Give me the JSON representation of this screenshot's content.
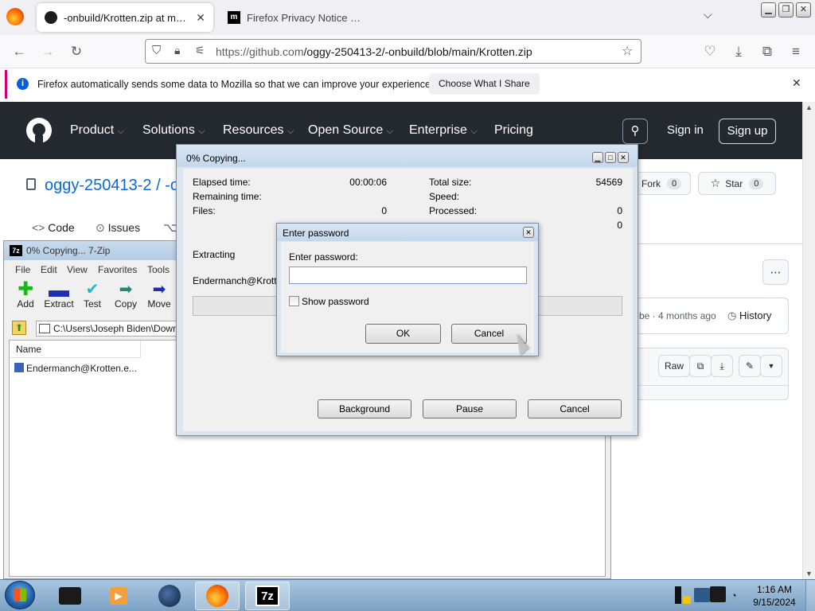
{
  "browser": {
    "tabs": [
      {
        "label": "-onbuild/Krotten.zip at main · o",
        "active": true
      },
      {
        "label": "Firefox Privacy Notice — Mo",
        "active": false
      }
    ],
    "url_domain": "https://github.com",
    "url_path": "/oggy-250413-2/-onbuild/blob/main/Krotten.zip",
    "notification": {
      "message": "Firefox automatically sends some data to Mozilla so that we can improve your experience.",
      "button": "Choose What I Share"
    }
  },
  "github": {
    "nav": [
      "Product",
      "Solutions",
      "Resources",
      "Open Source",
      "Enterprise",
      "Pricing"
    ],
    "sign_in": "Sign in",
    "sign_up": "Sign up",
    "repo_owner": "oggy-250413-2",
    "repo_sep": "/ -o",
    "fork_label": "Fork",
    "fork_count": "0",
    "star_label": "Star",
    "star_count": "0",
    "tabs": [
      "Code",
      "Issues"
    ],
    "commit_info": "be · 4 months ago",
    "history": "History",
    "raw": "Raw"
  },
  "sevenzip": {
    "title": "0% Copying... 7-Zip",
    "menu": [
      "File",
      "Edit",
      "View",
      "Favorites",
      "Tools"
    ],
    "toolbar": [
      "Add",
      "Extract",
      "Test",
      "Copy",
      "Move"
    ],
    "path": "C:\\Users\\Joseph Biden\\Down",
    "column_name": "Name",
    "file": "Endermanch@Krotten.e..."
  },
  "progress": {
    "title": "0% Copying...",
    "elapsed_label": "Elapsed time:",
    "elapsed_value": "00:00:06",
    "remaining_label": "Remaining time:",
    "files_label": "Files:",
    "files_value": "0",
    "total_label": "Total size:",
    "total_value": "54569",
    "speed_label": "Speed:",
    "processed_label": "Processed:",
    "processed_value": "0",
    "extra_value": "0",
    "extracting_label": "Extracting",
    "current_file": "Endermanch@Krotten",
    "progress_fraction": 0,
    "buttons": {
      "background": "Background",
      "pause": "Pause",
      "cancel": "Cancel"
    }
  },
  "password_dialog": {
    "title": "Enter password",
    "prompt": "Enter password:",
    "value": "",
    "show_password": "Show password",
    "ok": "OK",
    "cancel": "Cancel"
  },
  "taskbar": {
    "time": "1:16 AM",
    "date": "9/15/2024",
    "zip_label": "7z"
  }
}
